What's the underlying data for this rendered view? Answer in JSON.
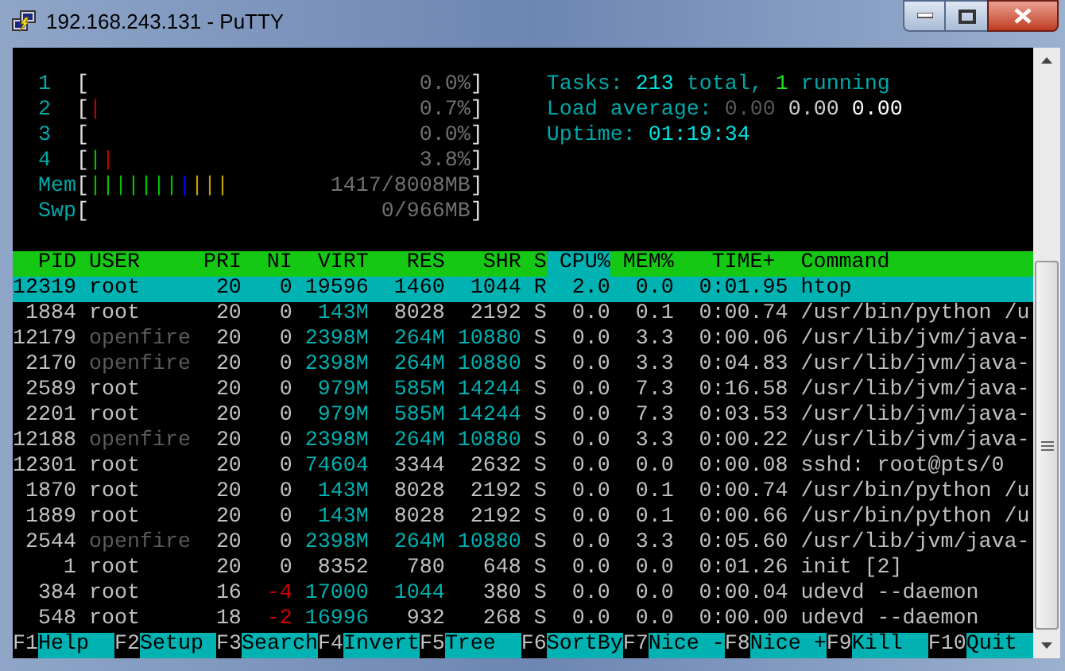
{
  "window": {
    "title": "192.168.243.131 - PuTTY"
  },
  "meters": [
    {
      "label": "1",
      "open": "[",
      "reading": "0.0%",
      "close": "]"
    },
    {
      "label": "2",
      "open": "[",
      "bars": [
        {
          "text": "|",
          "kind": "kernel"
        }
      ],
      "reading": "0.7%",
      "close": "]"
    },
    {
      "label": "3",
      "open": "[",
      "reading": "0.0%",
      "close": "]"
    },
    {
      "label": "4",
      "open": "[",
      "bars": [
        {
          "text": "|",
          "kind": "user"
        },
        {
          "text": "|",
          "kind": "kernel"
        }
      ],
      "reading": "3.8%",
      "close": "]"
    },
    {
      "label": "Mem",
      "open": "[",
      "bars": [
        {
          "text": "|||||||",
          "kind": "user"
        },
        {
          "text": "|",
          "kind": "buffers"
        },
        {
          "text": "|||",
          "kind": "cache"
        }
      ],
      "reading": "1417/8008MB",
      "close": "]"
    },
    {
      "label": "Swp",
      "open": "[",
      "reading": "0/966MB",
      "close": "]"
    }
  ],
  "tasks": {
    "label": "Tasks:",
    "total": "213",
    "total_suffix": "total,",
    "running": "1",
    "running_suffix": "running"
  },
  "load": {
    "label": "Load average:",
    "values": [
      "0.00",
      "0.00",
      "0.00"
    ]
  },
  "uptime": {
    "label": "Uptime:",
    "value": "01:19:34"
  },
  "columns": [
    {
      "label": "PID",
      "selected": false
    },
    {
      "label": "USER",
      "selected": false
    },
    {
      "label": "PRI",
      "selected": false
    },
    {
      "label": "NI",
      "selected": false
    },
    {
      "label": "VIRT",
      "selected": false
    },
    {
      "label": "RES",
      "selected": false
    },
    {
      "label": "SHR",
      "selected": false
    },
    {
      "label": "S",
      "selected": false
    },
    {
      "label": "CPU%",
      "selected": true
    },
    {
      "label": "MEM%",
      "selected": false
    },
    {
      "label": "TIME+",
      "selected": false
    },
    {
      "label": "Command",
      "selected": false
    }
  ],
  "processes": [
    {
      "selected": true,
      "pid": "12319",
      "user": {
        "text": "root"
      },
      "pri": "20",
      "ni": {
        "text": "0"
      },
      "virt": {
        "text": "19596"
      },
      "res": {
        "text": "1460"
      },
      "shr": {
        "text": "1044"
      },
      "state": "R",
      "cpu": "2.0",
      "mem": "0.0",
      "time": "0:01.95",
      "command": "htop"
    },
    {
      "selected": false,
      "pid": "1884",
      "user": {
        "text": "root",
        "dimmed": false
      },
      "pri": "20",
      "ni": {
        "text": "0",
        "negative": false
      },
      "virt": {
        "text": "143M",
        "large": true
      },
      "res": {
        "text": "8028",
        "large": false
      },
      "shr": {
        "text": "2192",
        "large": false
      },
      "state": "S",
      "cpu": "0.0",
      "mem": "0.1",
      "time": "0:00.74",
      "command": "/usr/bin/python /u"
    },
    {
      "selected": false,
      "pid": "12179",
      "user": {
        "text": "openfire",
        "dimmed": true
      },
      "pri": "20",
      "ni": {
        "text": "0",
        "negative": false
      },
      "virt": {
        "text": "2398M",
        "large": true
      },
      "res": {
        "text": "264M",
        "large": true
      },
      "shr": {
        "text": "10880",
        "large": true
      },
      "state": "S",
      "cpu": "0.0",
      "mem": "3.3",
      "time": "0:00.06",
      "command": "/usr/lib/jvm/java-"
    },
    {
      "selected": false,
      "pid": "2170",
      "user": {
        "text": "openfire",
        "dimmed": true
      },
      "pri": "20",
      "ni": {
        "text": "0",
        "negative": false
      },
      "virt": {
        "text": "2398M",
        "large": true
      },
      "res": {
        "text": "264M",
        "large": true
      },
      "shr": {
        "text": "10880",
        "large": true
      },
      "state": "S",
      "cpu": "0.0",
      "mem": "3.3",
      "time": "0:04.83",
      "command": "/usr/lib/jvm/java-"
    },
    {
      "selected": false,
      "pid": "2589",
      "user": {
        "text": "root",
        "dimmed": false
      },
      "pri": "20",
      "ni": {
        "text": "0",
        "negative": false
      },
      "virt": {
        "text": "979M",
        "large": true
      },
      "res": {
        "text": "585M",
        "large": true
      },
      "shr": {
        "text": "14244",
        "large": true
      },
      "state": "S",
      "cpu": "0.0",
      "mem": "7.3",
      "time": "0:16.58",
      "command": "/usr/lib/jvm/java-"
    },
    {
      "selected": false,
      "pid": "2201",
      "user": {
        "text": "root",
        "dimmed": false
      },
      "pri": "20",
      "ni": {
        "text": "0",
        "negative": false
      },
      "virt": {
        "text": "979M",
        "large": true
      },
      "res": {
        "text": "585M",
        "large": true
      },
      "shr": {
        "text": "14244",
        "large": true
      },
      "state": "S",
      "cpu": "0.0",
      "mem": "7.3",
      "time": "0:03.53",
      "command": "/usr/lib/jvm/java-"
    },
    {
      "selected": false,
      "pid": "12188",
      "user": {
        "text": "openfire",
        "dimmed": true
      },
      "pri": "20",
      "ni": {
        "text": "0",
        "negative": false
      },
      "virt": {
        "text": "2398M",
        "large": true
      },
      "res": {
        "text": "264M",
        "large": true
      },
      "shr": {
        "text": "10880",
        "large": true
      },
      "state": "S",
      "cpu": "0.0",
      "mem": "3.3",
      "time": "0:00.22",
      "command": "/usr/lib/jvm/java-"
    },
    {
      "selected": false,
      "pid": "12301",
      "user": {
        "text": "root",
        "dimmed": false
      },
      "pri": "20",
      "ni": {
        "text": "0",
        "negative": false
      },
      "virt": {
        "text": "74604",
        "large": true
      },
      "res": {
        "text": "3344",
        "large": false
      },
      "shr": {
        "text": "2632",
        "large": false
      },
      "state": "S",
      "cpu": "0.0",
      "mem": "0.0",
      "time": "0:00.08",
      "command": "sshd: root@pts/0"
    },
    {
      "selected": false,
      "pid": "1870",
      "user": {
        "text": "root",
        "dimmed": false
      },
      "pri": "20",
      "ni": {
        "text": "0",
        "negative": false
      },
      "virt": {
        "text": "143M",
        "large": true
      },
      "res": {
        "text": "8028",
        "large": false
      },
      "shr": {
        "text": "2192",
        "large": false
      },
      "state": "S",
      "cpu": "0.0",
      "mem": "0.1",
      "time": "0:00.74",
      "command": "/usr/bin/python /u"
    },
    {
      "selected": false,
      "pid": "1889",
      "user": {
        "text": "root",
        "dimmed": false
      },
      "pri": "20",
      "ni": {
        "text": "0",
        "negative": false
      },
      "virt": {
        "text": "143M",
        "large": true
      },
      "res": {
        "text": "8028",
        "large": false
      },
      "shr": {
        "text": "2192",
        "large": false
      },
      "state": "S",
      "cpu": "0.0",
      "mem": "0.1",
      "time": "0:00.66",
      "command": "/usr/bin/python /u"
    },
    {
      "selected": false,
      "pid": "2544",
      "user": {
        "text": "openfire",
        "dimmed": true
      },
      "pri": "20",
      "ni": {
        "text": "0",
        "negative": false
      },
      "virt": {
        "text": "2398M",
        "large": true
      },
      "res": {
        "text": "264M",
        "large": true
      },
      "shr": {
        "text": "10880",
        "large": true
      },
      "state": "S",
      "cpu": "0.0",
      "mem": "3.3",
      "time": "0:05.60",
      "command": "/usr/lib/jvm/java-"
    },
    {
      "selected": false,
      "pid": "1",
      "user": {
        "text": "root",
        "dimmed": false
      },
      "pri": "20",
      "ni": {
        "text": "0",
        "negative": false
      },
      "virt": {
        "text": "8352",
        "large": false
      },
      "res": {
        "text": "780",
        "large": false
      },
      "shr": {
        "text": "648",
        "large": false
      },
      "state": "S",
      "cpu": "0.0",
      "mem": "0.0",
      "time": "0:01.26",
      "command": "init [2]"
    },
    {
      "selected": false,
      "pid": "384",
      "user": {
        "text": "root",
        "dimmed": false
      },
      "pri": "16",
      "ni": {
        "text": "-4",
        "negative": true
      },
      "virt": {
        "text": "17000",
        "large": true
      },
      "res": {
        "text": "1044",
        "large": true
      },
      "shr": {
        "text": "380",
        "large": false
      },
      "state": "S",
      "cpu": "0.0",
      "mem": "0.0",
      "time": "0:00.04",
      "command": "udevd --daemon"
    },
    {
      "selected": false,
      "pid": "548",
      "user": {
        "text": "root",
        "dimmed": false
      },
      "pri": "18",
      "ni": {
        "text": "-2",
        "negative": true
      },
      "virt": {
        "text": "16996",
        "large": true
      },
      "res": {
        "text": "932",
        "large": false
      },
      "shr": {
        "text": "268",
        "large": false
      },
      "state": "S",
      "cpu": "0.0",
      "mem": "0.0",
      "time": "0:00.00",
      "command": "udevd --daemon"
    }
  ],
  "function_keys": [
    {
      "key": "F1",
      "label": "Help"
    },
    {
      "key": "F2",
      "label": "Setup"
    },
    {
      "key": "F3",
      "label": "Search"
    },
    {
      "key": "F4",
      "label": "Invert"
    },
    {
      "key": "F5",
      "label": "Tree"
    },
    {
      "key": "F6",
      "label": "SortBy"
    },
    {
      "key": "F7",
      "label": "Nice -"
    },
    {
      "key": "F8",
      "label": "Nice +"
    },
    {
      "key": "F9",
      "label": "Kill"
    },
    {
      "key": "F10",
      "label": "Quit"
    }
  ]
}
